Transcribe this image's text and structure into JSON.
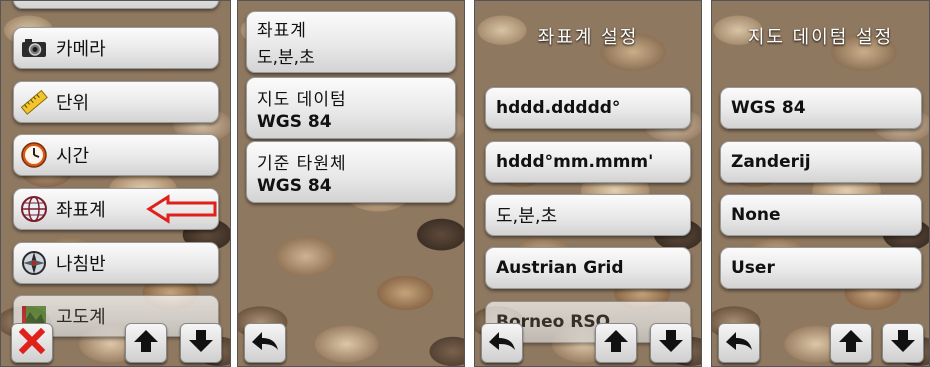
{
  "panel1": {
    "menu": [
      {
        "label": "카메라",
        "icon": "camera-icon"
      },
      {
        "label": "단위",
        "icon": "ruler-icon"
      },
      {
        "label": "시간",
        "icon": "clock-icon"
      },
      {
        "label": "좌표계",
        "icon": "globe-icon"
      },
      {
        "label": "나침반",
        "icon": "compass-icon"
      },
      {
        "label": "고도계",
        "icon": "altimeter-icon"
      }
    ],
    "highlight_color": "#e0201b"
  },
  "panel2": {
    "settings": [
      {
        "title": "좌표계",
        "value": "도,분,초"
      },
      {
        "title": "지도 데이텀",
        "value": "WGS 84"
      },
      {
        "title": "기준 타원체",
        "value": "WGS 84"
      }
    ]
  },
  "panel3": {
    "title": "좌표계 설정",
    "options": [
      "hddd.ddddd°",
      "hddd°mm.mmm'",
      "도,분,초",
      "Austrian Grid",
      "Borneo RSO"
    ]
  },
  "panel4": {
    "title": "지도 데이텀 설정",
    "options": [
      "WGS 84",
      "Zanderij",
      "None",
      "User"
    ]
  }
}
